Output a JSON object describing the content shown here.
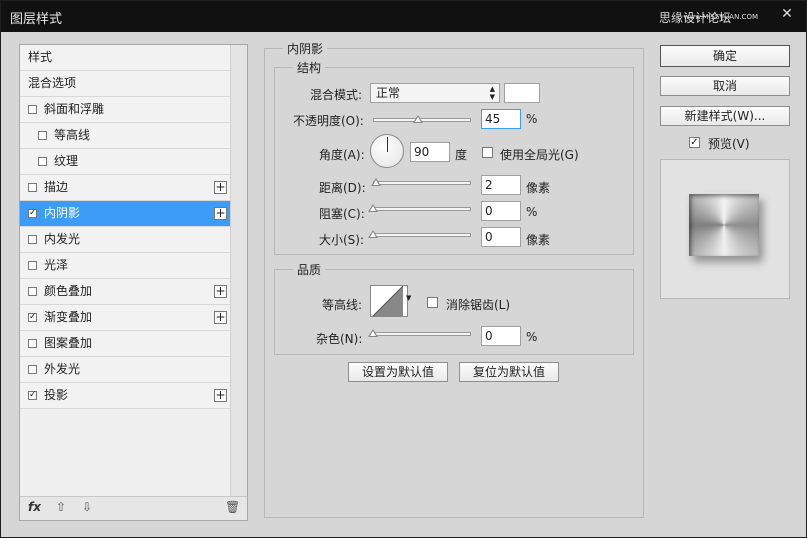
{
  "window": {
    "title": "图层样式",
    "watermark": "思缘设计论坛",
    "watermark_url": "www.MISSVUAN.COM"
  },
  "style_list": {
    "items": [
      {
        "label": "样式",
        "checkbox": false,
        "checked": false,
        "plus": false,
        "indent": 0,
        "selected": false
      },
      {
        "label": "混合选项",
        "checkbox": false,
        "checked": false,
        "plus": false,
        "indent": 0,
        "selected": false
      },
      {
        "label": "斜面和浮雕",
        "checkbox": true,
        "checked": false,
        "plus": false,
        "indent": 0,
        "selected": false
      },
      {
        "label": "等高线",
        "checkbox": true,
        "checked": false,
        "plus": false,
        "indent": 1,
        "selected": false
      },
      {
        "label": "纹理",
        "checkbox": true,
        "checked": false,
        "plus": false,
        "indent": 1,
        "selected": false
      },
      {
        "label": "描边",
        "checkbox": true,
        "checked": false,
        "plus": true,
        "indent": 0,
        "selected": false
      },
      {
        "label": "内阴影",
        "checkbox": true,
        "checked": true,
        "plus": true,
        "indent": 0,
        "selected": true
      },
      {
        "label": "内发光",
        "checkbox": true,
        "checked": false,
        "plus": false,
        "indent": 0,
        "selected": false
      },
      {
        "label": "光泽",
        "checkbox": true,
        "checked": false,
        "plus": false,
        "indent": 0,
        "selected": false
      },
      {
        "label": "颜色叠加",
        "checkbox": true,
        "checked": false,
        "plus": true,
        "indent": 0,
        "selected": false
      },
      {
        "label": "渐变叠加",
        "checkbox": true,
        "checked": true,
        "plus": true,
        "indent": 0,
        "selected": false
      },
      {
        "label": "图案叠加",
        "checkbox": true,
        "checked": false,
        "plus": false,
        "indent": 0,
        "selected": false
      },
      {
        "label": "外发光",
        "checkbox": true,
        "checked": false,
        "plus": false,
        "indent": 0,
        "selected": false
      },
      {
        "label": "投影",
        "checkbox": true,
        "checked": true,
        "plus": true,
        "indent": 0,
        "selected": false
      }
    ],
    "footer": {
      "fx": "fx",
      "up_icon": "arrow-up-icon",
      "down_icon": "arrow-down-icon",
      "trash_icon": "trash-icon"
    }
  },
  "panel": {
    "title": "内阴影",
    "structure": {
      "legend": "结构",
      "blend_mode_label": "混合模式:",
      "blend_mode_value": "正常",
      "blend_color": "#ffffff",
      "opacity_label": "不透明度(O):",
      "opacity_value": "45",
      "opacity_unit": "%",
      "opacity_fraction": 0.45,
      "angle_label": "角度(A):",
      "angle_value": "90",
      "angle_unit": "度",
      "global_light_label": "使用全局光(G)",
      "global_light_checked": false,
      "distance_label": "距离(D):",
      "distance_value": "2",
      "distance_unit": "像素",
      "choke_label": "阻塞(C):",
      "choke_value": "0",
      "choke_unit": "%",
      "size_label": "大小(S):",
      "size_value": "0",
      "size_unit": "像素"
    },
    "quality": {
      "legend": "品质",
      "contour_label": "等高线:",
      "antialias_label": "消除锯齿(L)",
      "antialias_checked": false,
      "noise_label": "杂色(N):",
      "noise_value": "0",
      "noise_unit": "%"
    },
    "make_default": "设置为默认值",
    "reset_default": "复位为默认值"
  },
  "buttons": {
    "ok": "确定",
    "cancel": "取消",
    "new_style": "新建样式(W)...",
    "preview_label": "预览(V)",
    "preview_checked": true
  }
}
